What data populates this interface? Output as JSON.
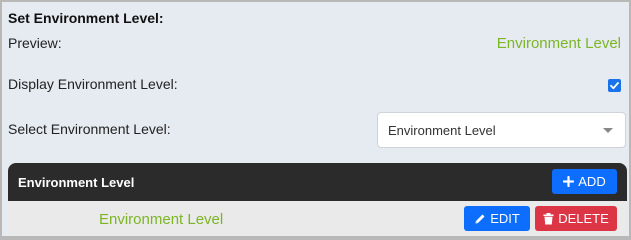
{
  "settings": {
    "title": "Set Environment Level:",
    "preview_label": "Preview:",
    "preview_value": "Environment Level",
    "display_label": "Display Environment Level:",
    "display_checked": true,
    "select_label": "Select Environment Level:",
    "select_value": "Environment Level"
  },
  "table": {
    "header_title": "Environment Level",
    "add_label": "ADD",
    "rows": [
      {
        "value": "Environment Level",
        "edit_label": "EDIT",
        "delete_label": "DELETE"
      }
    ]
  },
  "colors": {
    "accent_green": "#7cb526",
    "primary_blue": "#0d6efd",
    "danger_red": "#dc3545",
    "header_dark": "#2b2b2b",
    "panel_bg": "#e6ebf2"
  },
  "icons": {
    "add": "plus-icon",
    "edit": "pencil-icon",
    "delete": "trash-icon",
    "select": "chevron-down-icon",
    "checkbox": "check-icon"
  }
}
